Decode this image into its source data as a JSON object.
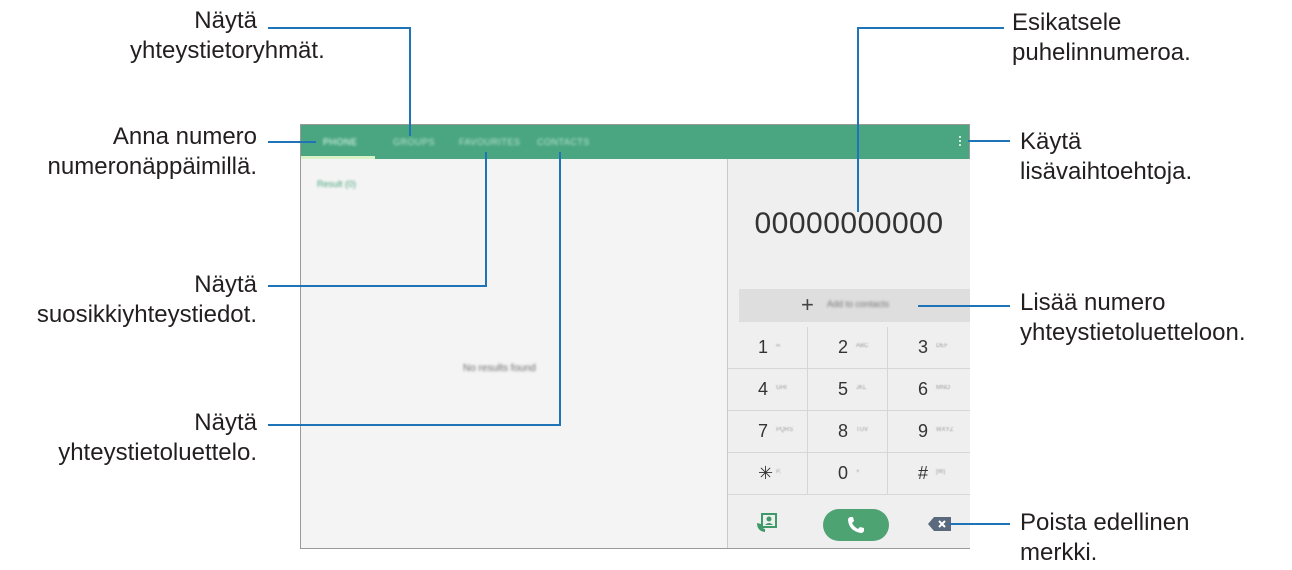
{
  "callouts": {
    "groups": [
      "Näytä",
      "yhteystietoryhmät."
    ],
    "keypad": [
      "Anna numero",
      "numeronäppäimillä."
    ],
    "favourites": [
      "Näytä",
      "suosikkiyhteystiedot."
    ],
    "contacts": [
      "Näytä",
      "yhteystietoluettelo."
    ],
    "preview": [
      "Esikatsele",
      "puhelinnumeroa."
    ],
    "options": [
      "Käytä",
      "lisävaihtoehtoja."
    ],
    "add": [
      "Lisää numero",
      "yhteystietoluetteloon."
    ],
    "delete": [
      "Poista edellinen",
      "merkki."
    ]
  },
  "tabs": [
    {
      "label": "PHONE",
      "active": true
    },
    {
      "label": "GROUPS",
      "active": false
    },
    {
      "label": "FAVOURITES",
      "active": false
    },
    {
      "label": "CONTACTS",
      "active": false
    }
  ],
  "left": {
    "result_label": "Result (0)",
    "empty_message": "No results found"
  },
  "dialer": {
    "number": "00000000000",
    "add_plus": "+",
    "add_label": "Add to contacts",
    "keys": [
      {
        "digit": "1",
        "letters": "∞"
      },
      {
        "digit": "2",
        "letters": "ABC"
      },
      {
        "digit": "3",
        "letters": "DEF"
      },
      {
        "digit": "4",
        "letters": "GHI"
      },
      {
        "digit": "5",
        "letters": "JKL"
      },
      {
        "digit": "6",
        "letters": "MNO"
      },
      {
        "digit": "7",
        "letters": "PQRS"
      },
      {
        "digit": "8",
        "letters": "TUV"
      },
      {
        "digit": "9",
        "letters": "WXYZ"
      },
      {
        "digit": "✳",
        "letters": "P,"
      },
      {
        "digit": "0",
        "letters": "+"
      },
      {
        "digit": "#",
        "letters": "[W]"
      }
    ]
  },
  "icons": {
    "menu": "more-vert-icon",
    "contacts": "contacts-icon",
    "call": "phone-icon",
    "backspace": "backspace-icon"
  },
  "colors": {
    "accent": "#4aa680",
    "call_button": "#4ea373",
    "leader_lines": "#1f73b7"
  }
}
